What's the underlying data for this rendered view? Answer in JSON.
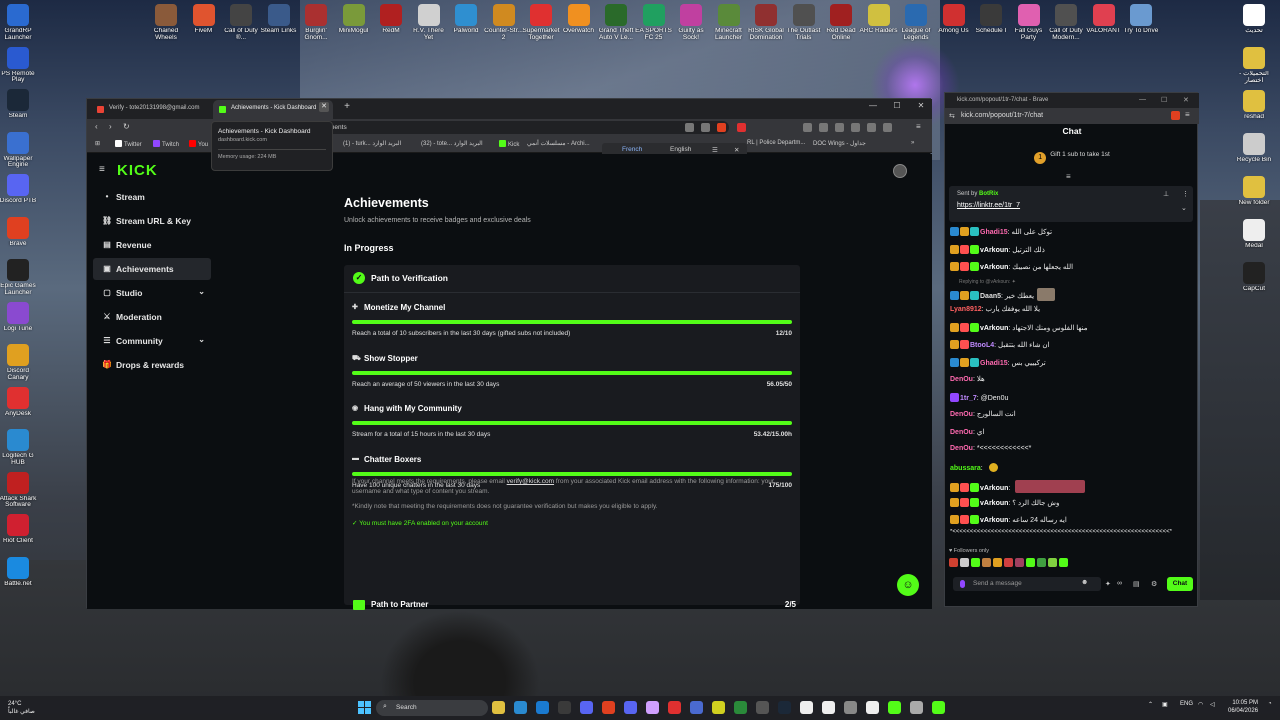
{
  "desktop": {
    "top_icons": [
      {
        "label": "Chained Wheels",
        "color": "#8a5a3a"
      },
      {
        "label": "FiveM",
        "color": "#e0542f"
      },
      {
        "label": "Call of Duty ®...",
        "color": "#444444"
      },
      {
        "label": "Steam Links",
        "color": "#3a5a8a"
      },
      {
        "label": "Burglin' Gnom...",
        "color": "#aa3030"
      },
      {
        "label": "MiniMogul",
        "color": "#7a9a3a"
      },
      {
        "label": "RedM",
        "color": "#b02020"
      },
      {
        "label": "R.V. There Yet",
        "color": "#d0d0d0"
      },
      {
        "label": "Palworld",
        "color": "#2f8fd0"
      },
      {
        "label": "Counter-Str... 2",
        "color": "#d08a20"
      },
      {
        "label": "Supermarket Together",
        "color": "#e03030"
      },
      {
        "label": "Overwatch",
        "color": "#f09020"
      },
      {
        "label": "Grand Theft Auto V Le...",
        "color": "#2a6a2a"
      },
      {
        "label": "EA SPORTS FC 25",
        "color": "#20a060"
      },
      {
        "label": "Guilty as Sock!",
        "color": "#c040a0"
      },
      {
        "label": "Minecraft Launcher",
        "color": "#5a8a3a"
      },
      {
        "label": "RISK Global Domination",
        "color": "#903030"
      },
      {
        "label": "The Outlast Trials",
        "color": "#505050"
      },
      {
        "label": "Red Dead Online",
        "color": "#a02020"
      },
      {
        "label": "ARC Raiders",
        "color": "#d0c040"
      },
      {
        "label": "League of Legends",
        "color": "#2a6ab0"
      },
      {
        "label": "Among Us",
        "color": "#d03030"
      },
      {
        "label": "Schedule I",
        "color": "#3a3a3a"
      },
      {
        "label": "Fall Guys Party",
        "color": "#e060b0"
      },
      {
        "label": "Call of Duty Modern...",
        "color": "#505050"
      },
      {
        "label": "VALORANT",
        "color": "#e04050"
      },
      {
        "label": "Try To Drive",
        "color": "#6a9ad0"
      }
    ],
    "left_icons": [
      {
        "label": "GrandRP Launcher",
        "color": "#2a6ad0"
      },
      {
        "label": "PS Remote Play",
        "color": "#2a5ad0"
      },
      {
        "label": "Steam",
        "color": "#1b2838"
      },
      {
        "label": "Wallpaper Engine",
        "color": "#3a70d0"
      },
      {
        "label": "Discord PTB",
        "color": "#5865f2"
      },
      {
        "label": "Brave",
        "color": "#e04020"
      },
      {
        "label": "Epic Games Launcher",
        "color": "#222222"
      },
      {
        "label": "Logi Tune",
        "color": "#8a4ad0"
      },
      {
        "label": "Discord Canary",
        "color": "#e0a020"
      },
      {
        "label": "AnyDesk",
        "color": "#e03030"
      },
      {
        "label": "Logitech G HUB",
        "color": "#2a8ad0"
      },
      {
        "label": "Attack Shark Software",
        "color": "#c02020"
      },
      {
        "label": "Riot Client",
        "color": "#d02030"
      },
      {
        "label": "Battle.net",
        "color": "#1a8ae0"
      }
    ],
    "right_icons": [
      {
        "label": "تحديث",
        "color": "#ffffff"
      },
      {
        "label": "التحميلات - اختصار",
        "color": "#e0c040"
      },
      {
        "label": "reshad",
        "color": "#e0c040"
      },
      {
        "label": "Recycle Bin",
        "color": "#cccccc"
      },
      {
        "label": "New folder",
        "color": "#e0c040"
      },
      {
        "label": "Medal",
        "color": "#eeeeee"
      },
      {
        "label": "CapCut",
        "color": "#222222"
      }
    ]
  },
  "browser": {
    "tabs": [
      {
        "title": "Verify - tote20131998@gmail.com",
        "color": "#ea4335"
      },
      {
        "title": "Achievements - Kick Dashboard",
        "color": "#53fc18"
      }
    ],
    "tooltip": {
      "title": "Achievements - Kick Dashboard",
      "domain": "dashboard.kick.com",
      "memory": "Memory usage: 224 MB"
    },
    "url_fragment": "ments",
    "bookmarks": [
      "Twitter",
      "Twitch",
      "You",
      "(1) - turk... البريد الوارد",
      "(32) - tote... البريد الوارد",
      "Kick",
      "مسلسلات أنمي - Archi...",
      "RL | Police Departm...",
      "DOC Wings - جداول"
    ],
    "translate": {
      "french": "French",
      "english": "English"
    }
  },
  "kick": {
    "logo": "KICK",
    "sidebar": [
      {
        "label": "Stream",
        "icon": "broadcast-icon",
        "glyph": "((•))"
      },
      {
        "label": "Stream URL & Key",
        "icon": "link-icon",
        "glyph": "⛓"
      },
      {
        "label": "Revenue",
        "icon": "revenue-icon",
        "glyph": "▤"
      },
      {
        "label": "Achievements",
        "icon": "trophy-icon",
        "glyph": "▣"
      },
      {
        "label": "Studio",
        "icon": "studio-icon",
        "glyph": "▢"
      },
      {
        "label": "Moderation",
        "icon": "sword-icon",
        "glyph": "⚔"
      },
      {
        "label": "Community",
        "icon": "community-icon",
        "glyph": "☰"
      },
      {
        "label": "Drops & rewards",
        "icon": "gift-icon",
        "glyph": "🎁"
      }
    ],
    "title": "Achievements",
    "subtitle": "Unlock achievements to receive badges and exclusive deals",
    "section": "In Progress",
    "card_title": "Path to Verification",
    "tasks": [
      {
        "title": "Monetize My Channel",
        "desc": "Reach a total of 10 subscribers in the last 30 days (gifted subs not included)",
        "value": "12/10",
        "progress": 1.0,
        "icon": "gift-icon",
        "glyph": "✚"
      },
      {
        "title": "Show Stopper",
        "desc": "Reach an average of 50 viewers in the last 30 days",
        "value": "56.05/50",
        "progress": 1.0,
        "icon": "viewers-icon",
        "glyph": "⛟"
      },
      {
        "title": "Hang with My Community",
        "desc": "Stream for a total of 15 hours in the last 30 days",
        "value": "53.42/15.00h",
        "progress": 1.0,
        "icon": "broadcast-icon",
        "glyph": "◉"
      },
      {
        "title": "Chatter Boxers",
        "desc": "Have 100 unique chatters in the last 30 days",
        "value": "175/100",
        "progress": 1.0,
        "icon": "chat-icon",
        "glyph": "▬"
      }
    ],
    "info_pre": "If your channel meets the requirements, please email ",
    "info_link": "verify@kick.com",
    "info_post": " from your associated Kick email address with the following information: your username and what type of content you stream.",
    "info_note": "*Kindly note that meeting the requirements does not guarantee verification but makes you eligible to apply.",
    "requirement": "You must have 2FA enabled on your account",
    "next_card_title": "Path to Partner",
    "next_card_value": "2/5"
  },
  "chat": {
    "window_title": "kick.com/popout/1tr-7/chat - Brave",
    "address": "kick.com/popout/1tr-7/chat",
    "header": "Chat",
    "gift_text": "Gift 1 sub to take 1st",
    "gift_count": "1",
    "pinned_by_prefix": "Sent by",
    "pinned_by": "BotRix",
    "pinned_link": "https://linktr.ee/1tr_7",
    "reply_note": "Replying to @vArkoun: ✦",
    "messages": [
      {
        "user": "Ghadi15",
        "color": "#ff6ab0",
        "text": "توكل على الله",
        "badges": [
          "#2a8ad0",
          "#e0a020",
          "#2ac0c0"
        ]
      },
      {
        "user": "vArkoun",
        "color": "#ffffff",
        "text": "ذلك الترتيل",
        "badges": [
          "#e0a020",
          "#ff5050",
          "#53fc18"
        ]
      },
      {
        "user": "vArkoun",
        "color": "#ffffff",
        "text": "الله يجعلها من نصيبك",
        "badges": [
          "#e0a020",
          "#ff5050",
          "#53fc18"
        ]
      },
      {
        "user": "Daan5",
        "color": "#e0e0e0",
        "text": "يعطك خير",
        "badges": [
          "#2a8ad0",
          "#e0a020",
          "#2ac0c0"
        ]
      },
      {
        "user": "Lyan8912",
        "color": "#ff6060",
        "text": "يلا الله يوفقك يارب",
        "badges": []
      },
      {
        "user": "vArkoun",
        "color": "#ffffff",
        "text": "منها الفلوس ومنك الاجتهاد",
        "badges": [
          "#e0a020",
          "#ff5050",
          "#53fc18"
        ]
      },
      {
        "user": "BtooL4",
        "color": "#c08aff",
        "text": "ان شاء الله بتتقبل",
        "badges": [
          "#e0a020",
          "#ff5050"
        ]
      },
      {
        "user": "Ghadi15",
        "color": "#ff6ab0",
        "text": "تركيييي بس",
        "badges": [
          "#2a8ad0",
          "#e0a020",
          "#2ac0c0"
        ]
      },
      {
        "user": "DenOu",
        "color": "#ff6ab0",
        "text": "هلا",
        "badges": []
      },
      {
        "user": "1tr_7",
        "color": "#c08aff",
        "text": "@Den0u",
        "badges": [
          "#9147ff"
        ]
      },
      {
        "user": "DenOu",
        "color": "#ff6ab0",
        "text": "انت السالورج",
        "badges": []
      },
      {
        "user": "DenOu",
        "color": "#ff6ab0",
        "text": "اي",
        "badges": []
      },
      {
        "user": "DenOu",
        "color": "#ff6ab0",
        "text": "*<<<<<<<<<<<<*",
        "badges": []
      },
      {
        "user": "abussara",
        "color": "#53fc18",
        "text": "",
        "badges": []
      },
      {
        "user": "vArkoun",
        "color": "#ffffff",
        "text": "",
        "badges": [
          "#e0a020",
          "#ff5050",
          "#53fc18"
        ]
      },
      {
        "user": "vArkoun",
        "color": "#ffffff",
        "text": "وش جالك الرد ؟",
        "badges": [
          "#e0a020",
          "#ff5050",
          "#53fc18"
        ]
      },
      {
        "user": "vArkoun",
        "color": "#ffffff",
        "text": "ايه رساله 24 ساعه",
        "badges": [
          "#e0a020",
          "#ff5050",
          "#53fc18"
        ]
      }
    ],
    "spam_line": "*<<<<<<<<<<<<<<<<<<<<<<<<<<<<<<<<<<<<<<<<<<<<<<<<<<<<<<<<<<<<<<*",
    "followers_only": "Followers only",
    "input_placeholder": "Send a message",
    "send_label": "Chat"
  },
  "taskbar": {
    "weather_temp": "24°C",
    "weather_text": "صافي غالباً",
    "search_label": "Search",
    "lang": "ENG",
    "time": "10:05 PM",
    "date": "06/04/2026",
    "apps": [
      "#e0c040",
      "#2a8ad0",
      "#1a7ad0",
      "#3a3a3a",
      "#5865f2",
      "#e04020",
      "#5865f2",
      "#d0a0ff",
      "#e03030",
      "#4a6ad0",
      "#d0d020",
      "#2a8a3a",
      "#555555",
      "#1b2838",
      "#eeeeee",
      "#eeeeee",
      "#888888",
      "#eeeeee",
      "#53fc18",
      "#aaaaaa",
      "#53fc18"
    ]
  }
}
